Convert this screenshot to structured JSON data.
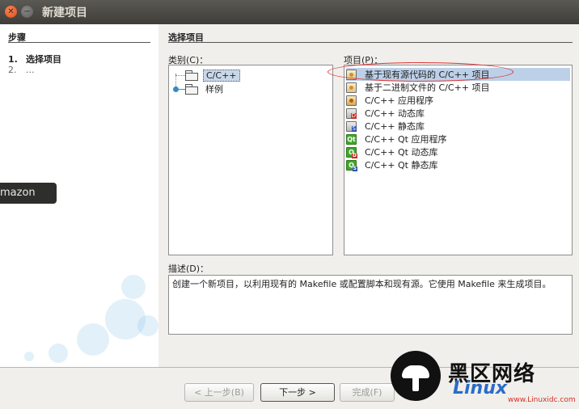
{
  "window": {
    "title": "新建项目",
    "close_glyph": "✕",
    "min_glyph": "−"
  },
  "steps": {
    "title": "步骤",
    "items": [
      {
        "num": "1.",
        "label": "选择项目"
      },
      {
        "num": "2.",
        "label": "..."
      }
    ]
  },
  "overlay": {
    "amazon_label": "mazon"
  },
  "main": {
    "section_title": "选择项目",
    "category_label": "类别(C)：",
    "project_label": "项目(P)：",
    "categories": [
      {
        "label": "C/C++",
        "icon": "folder-icon",
        "selected": true
      },
      {
        "label": "样例",
        "icon": "folder-icon",
        "selected": false
      }
    ],
    "projects": [
      {
        "label": "基于现有源代码的 C/C++ 项目",
        "icon": "source-project-icon",
        "selected": true
      },
      {
        "label": "基于二进制文件的 C/C++ 项目",
        "icon": "binary-project-icon",
        "selected": false
      },
      {
        "label": "C/C++ 应用程序",
        "icon": "application-icon",
        "selected": false
      },
      {
        "label": "C/C++ 动态库",
        "icon": "dynamic-library-icon",
        "selected": false
      },
      {
        "label": "C/C++ 静态库",
        "icon": "static-library-icon",
        "selected": false
      },
      {
        "label": "C/C++ Qt 应用程序",
        "icon": "qt-application-icon",
        "selected": false
      },
      {
        "label": "C/C++ Qt 动态库",
        "icon": "qt-dynamic-library-icon",
        "selected": false
      },
      {
        "label": "C/C++ Qt 静态库",
        "icon": "qt-static-library-icon",
        "selected": false
      }
    ],
    "description_label": "描述(D)：",
    "description": "创建一个新项目，以利用现有的 Makefile 或配置脚本和现有源。它使用 Makefile 来生成项目。"
  },
  "buttons": {
    "back": "< 上一步(B)",
    "next": "下一步 >",
    "finish": "完成(F)"
  },
  "watermark": {
    "cn": "黑区网络",
    "en": "Linux",
    "url": "www.Linuxidc.com"
  },
  "colors": {
    "selection": "#bcd0e8",
    "annotation": "#e03030",
    "title_bar": "#3e3d39"
  }
}
